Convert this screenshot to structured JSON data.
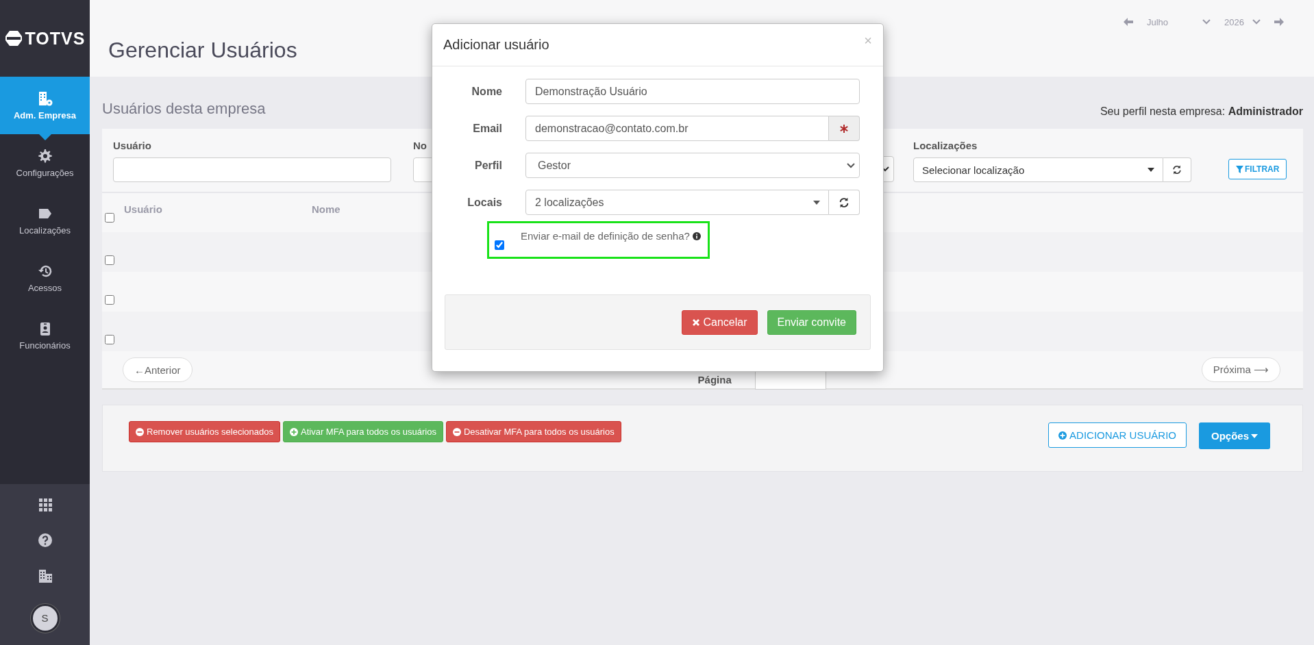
{
  "sidebar": {
    "logo": "TOTVS",
    "items": [
      {
        "label": "Adm. Empresa",
        "selected": true
      },
      {
        "label": "Configurações",
        "selected": false
      },
      {
        "label": "Localizações",
        "selected": false
      },
      {
        "label": "Acessos",
        "selected": false
      },
      {
        "label": "Funcionários",
        "selected": false
      }
    ],
    "avatar": "S"
  },
  "header": {
    "title": "Gerenciar Usuários",
    "month": "Julho",
    "year": "2026"
  },
  "section": {
    "title": "Usuários desta empresa",
    "profile": "Seu perfil nesta empresa: **Administrador**"
  },
  "filters": {
    "user_label": "Usuário",
    "name_label": "No",
    "locations_label": "Localizações",
    "locations_placeholder": "Selecionar localização",
    "filter_button": "FILTRAR"
  },
  "table": {
    "columns": [
      "Usuário",
      "Nome"
    ],
    "header_checked": false,
    "rows": [
      {
        "checked": false
      },
      {
        "checked": false
      },
      {
        "checked": false
      }
    ]
  },
  "pagination": {
    "previous": "←Anterior",
    "page_label": "Página",
    "next": "Próxima ⟶"
  },
  "actions": [
    {
      "label": "Remover usuários selecionados",
      "kind": "danger"
    },
    {
      "label": "Ativar MFA para todos os usuários",
      "kind": "success"
    },
    {
      "label": "Desativar MFA para todos os usuários",
      "kind": "danger"
    }
  ],
  "add_button": "ADICIONAR USUÁRIO",
  "options_button": "Opções",
  "modal": {
    "title": "Adicionar usuário",
    "close": "×",
    "fields": [
      {
        "label": "Nome",
        "value": "Demonstração Usuário",
        "kind": "text"
      },
      {
        "label": "Email",
        "value": "demonstracao@contato.com.br",
        "kind": "required"
      },
      {
        "label": "Perfil",
        "value": "Gestor",
        "kind": "select"
      },
      {
        "label": "Locais",
        "value": "2 localizações",
        "kind": "multiselect"
      }
    ],
    "send_email": {
      "label": "Enviar e-mail de definição de senha?",
      "checked": true
    },
    "cancel": "Cancelar",
    "submit": "Enviar convite"
  }
}
